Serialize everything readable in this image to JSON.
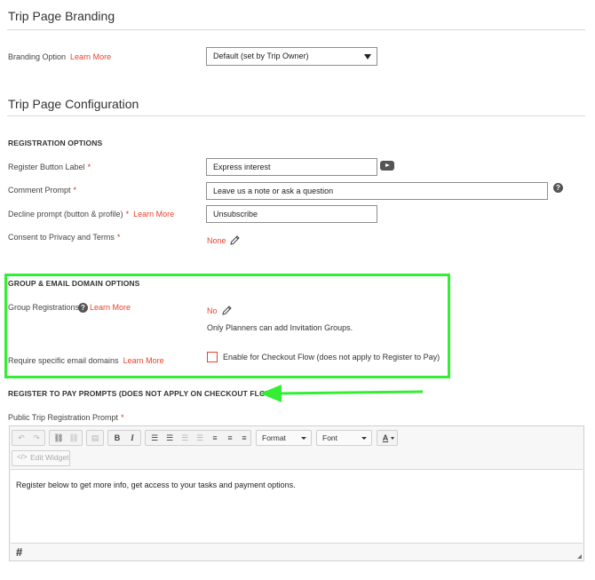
{
  "branding": {
    "title": "Trip Page Branding",
    "option_label": "Branding Option",
    "learn_more": "Learn More",
    "select_value": "Default (set by Trip Owner)"
  },
  "config": {
    "title": "Trip Page Configuration"
  },
  "registration": {
    "heading": "REGISTRATION OPTIONS",
    "register_button_label": "Register Button Label",
    "register_button_value": "Express interest",
    "comment_prompt_label": "Comment Prompt",
    "comment_prompt_value": "Leave us a note or ask a question",
    "decline_prompt_label": "Decline prompt (button & profile)",
    "decline_learn_more": "Learn More",
    "decline_prompt_value": "Unsubscribe",
    "consent_label": "Consent to Privacy and Terms",
    "consent_value": "None",
    "required_mark": "*"
  },
  "group": {
    "heading": "GROUP & EMAIL DOMAIN OPTIONS",
    "group_reg_label": "Group Registrations",
    "group_learn_more": "Learn More",
    "group_reg_value": "No",
    "group_note": "Only Planners can add Invitation Groups.",
    "email_label": "Require specific email domains",
    "email_learn_more": "Learn More",
    "checkout_label": "Enable for Checkout Flow (does not apply to Register to Pay)"
  },
  "pay": {
    "heading": "REGISTER TO PAY PROMPTS (DOES NOT APPLY ON CHECKOUT FLOW)",
    "prompt_label": "Public Trip Registration Prompt",
    "required_mark": "*"
  },
  "editor": {
    "format_label": "Format",
    "font_label": "Font",
    "edit_widget_label": "Edit Widget",
    "content": "Register below to get more info, get access to your tasks and payment options."
  },
  "colors": {
    "accent": "#e8432c",
    "highlight": "#33ee33"
  }
}
